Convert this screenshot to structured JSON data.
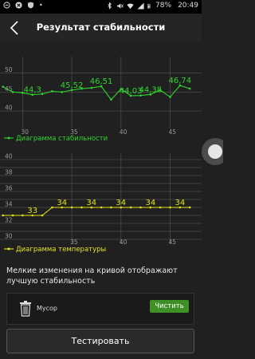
{
  "status_bar": {
    "battery": "78%",
    "time": "20:49"
  },
  "header": {
    "title": "Результат стабильности"
  },
  "stability_chart": {
    "type": "line",
    "x": [
      28,
      29,
      30,
      31,
      32,
      33,
      34,
      35,
      36,
      37,
      38,
      39,
      40,
      41,
      42,
      43,
      44,
      45,
      46,
      47
    ],
    "values": [
      46.4,
      45.0,
      44.8,
      44.3,
      44.5,
      45.2,
      45.0,
      45.52,
      45.9,
      46.1,
      46.51,
      43.0,
      45.8,
      44.03,
      44.1,
      44.38,
      45.5,
      43.7,
      46.74,
      45.9
    ],
    "labels": [
      {
        "x": 31,
        "text": "44,3"
      },
      {
        "x": 35,
        "text": "45,52"
      },
      {
        "x": 38,
        "text": "46,51"
      },
      {
        "x": 41,
        "text": "44,03"
      },
      {
        "x": 43,
        "text": "44,38"
      },
      {
        "x": 46,
        "text": "46,74"
      }
    ],
    "yticks": [
      40,
      45,
      50
    ],
    "y_tick_labels": [
      "40",
      "45",
      "50"
    ],
    "xticks": [
      30,
      35,
      40,
      45
    ],
    "x_tick_labels": [
      "30",
      "35",
      "40",
      "45"
    ],
    "ylim": [
      37.5,
      53.5
    ],
    "xlim": [
      27.7,
      48.2
    ],
    "legend": "Диаграмма стабильности",
    "color": "#2fd52f"
  },
  "temperature_chart": {
    "type": "line",
    "x": [
      28,
      29,
      30,
      31,
      32,
      33,
      34,
      35,
      36,
      37,
      38,
      39,
      40,
      41,
      42,
      43,
      44,
      45,
      46,
      47
    ],
    "values": [
      33,
      33,
      33,
      33,
      33,
      34,
      34,
      34,
      34,
      34,
      34,
      34,
      34,
      34,
      34,
      34,
      34,
      34,
      34,
      34
    ],
    "labels": [
      {
        "x": 31,
        "text": "33"
      },
      {
        "x": 34,
        "text": "34"
      },
      {
        "x": 37,
        "text": "34"
      },
      {
        "x": 40,
        "text": "34"
      },
      {
        "x": 43,
        "text": "34"
      },
      {
        "x": 46,
        "text": "34"
      }
    ],
    "yticks": [
      30,
      31,
      32,
      33,
      34,
      35,
      36,
      37,
      38,
      39,
      40
    ],
    "y_tick_labels": [
      "30",
      "",
      "32",
      "",
      "34",
      "",
      "36",
      "",
      "38",
      "",
      "40"
    ],
    "xticks": [
      35,
      40,
      45
    ],
    "x_tick_labels": [
      "35",
      "40",
      "45"
    ],
    "ylim": [
      29.6,
      40.4
    ],
    "xlim": [
      27.7,
      48.2
    ],
    "legend": "Диаграмма температуры",
    "color": "#e3e21d"
  },
  "note": "Мелкие изменения на кривой отображают лучшую стабильность",
  "trash": {
    "label": "Мусор",
    "button": "Чистить"
  },
  "test_button": "Тестировать"
}
